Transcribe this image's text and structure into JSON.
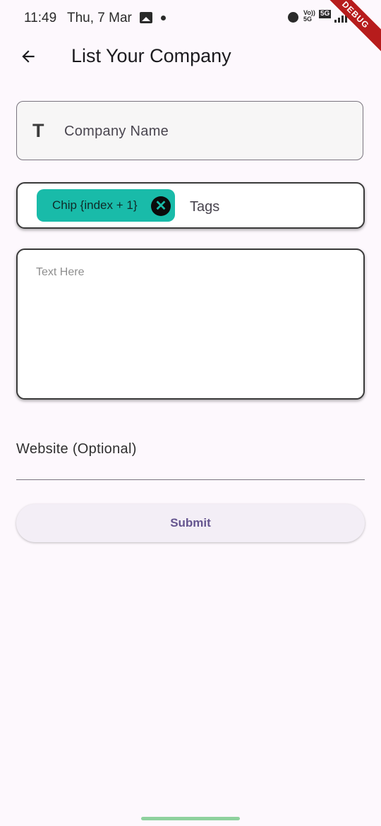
{
  "status_bar": {
    "time": "11:49",
    "date": "Thu, 7 Mar",
    "volte": "Vo))\n5G",
    "network": "5G",
    "debug_banner": "DEBUG"
  },
  "app_bar": {
    "title": "List Your Company",
    "back_icon": "arrow-back-icon"
  },
  "form": {
    "company_name_placeholder": "Company Name",
    "company_icon": "text-fields-icon",
    "tags": {
      "chips": [
        "Chip {index + 1}"
      ],
      "label": "Tags"
    },
    "text_area_placeholder": "Text Here",
    "website_label": "Website (Optional)",
    "submit_label": "Submit"
  },
  "colors": {
    "background": "#fdf8fd",
    "chip": "#19bba9",
    "submit_text": "#65558f",
    "debug_banner": "#b71c1c"
  }
}
